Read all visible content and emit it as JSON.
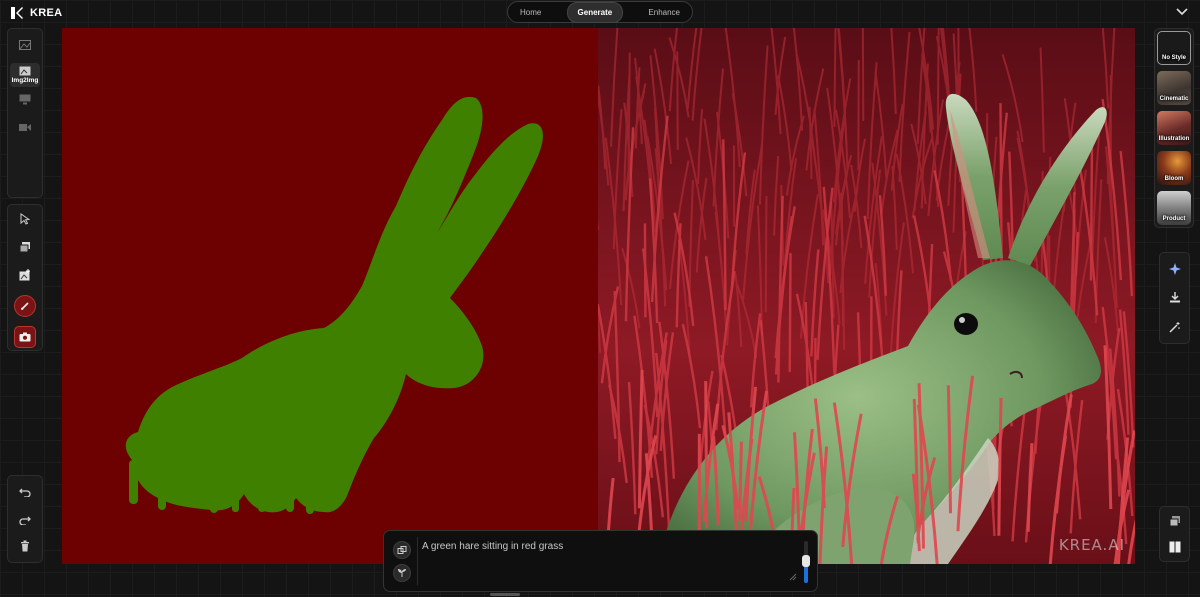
{
  "app": {
    "name": "KREA"
  },
  "nav": {
    "tabs": [
      {
        "label": "Home",
        "active": false
      },
      {
        "label": "Generate",
        "active": true
      },
      {
        "label": "Enhance",
        "active": false
      }
    ]
  },
  "left_toolbar": {
    "modes": [
      {
        "icon": "image-icon",
        "label": ""
      },
      {
        "icon": "img2img-icon",
        "label": "Img2Img",
        "selected": true
      },
      {
        "icon": "monitor-icon",
        "label": ""
      },
      {
        "icon": "video-icon",
        "label": ""
      }
    ],
    "tools": [
      "cursor-icon",
      "layers-icon",
      "image-add-icon",
      "brush-icon",
      "webcam-icon"
    ],
    "history": [
      "undo-icon",
      "redo-icon",
      "trash-icon"
    ]
  },
  "styles": {
    "items": [
      {
        "label": "No Style",
        "selected": true
      },
      {
        "label": "Cinematic"
      },
      {
        "label": "Illustration"
      },
      {
        "label": "Bloom"
      },
      {
        "label": "Product"
      }
    ]
  },
  "right_actions": [
    "sparkle-icon",
    "download-icon",
    "magic-icon"
  ],
  "right_bottom": [
    "stack-icon",
    "split-view-icon"
  ],
  "canvas": {
    "watermark": "KREA.AI",
    "fill_color": "#6d0000",
    "shape_color": "#3f8000"
  },
  "prompt": {
    "text": "A green hare sitting in red grass",
    "strength": 0.55
  },
  "colors": {
    "accent": "#1e6fe0",
    "brush_red": "#7a1414"
  }
}
